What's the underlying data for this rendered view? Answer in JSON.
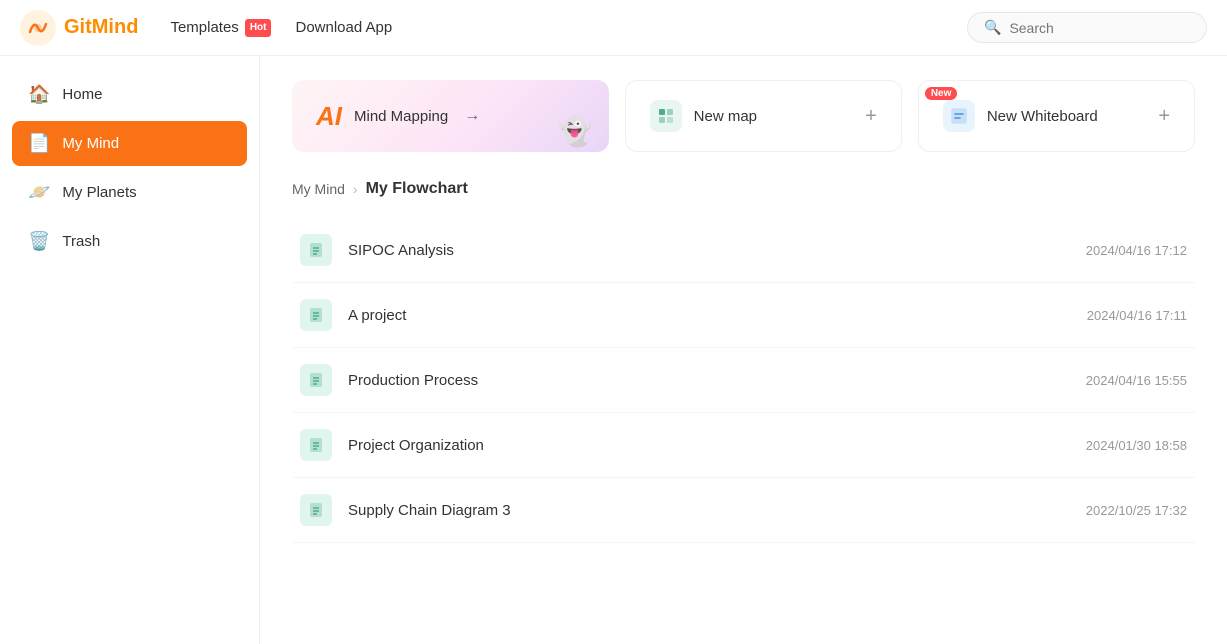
{
  "header": {
    "logo_text": "GitMind",
    "nav": [
      {
        "label": "Templates",
        "badge": "Hot"
      },
      {
        "label": "Download App"
      }
    ],
    "search_placeholder": "Search"
  },
  "sidebar": {
    "items": [
      {
        "id": "home",
        "label": "Home",
        "icon": "🏠",
        "active": false
      },
      {
        "id": "my-mind",
        "label": "My Mind",
        "icon": "📄",
        "active": true
      },
      {
        "id": "my-planets",
        "label": "My Planets",
        "icon": "🪐",
        "active": false
      },
      {
        "id": "trash",
        "label": "Trash",
        "icon": "🗑️",
        "active": false
      }
    ]
  },
  "action_cards": [
    {
      "id": "mind-mapping",
      "ai_label": "AI",
      "label": "Mind Mapping",
      "arrow": "→",
      "type": "mind"
    },
    {
      "id": "new-map",
      "label": "New map",
      "plus": "+",
      "type": "map"
    },
    {
      "id": "new-whiteboard",
      "label": "New Whiteboard",
      "plus": "+",
      "badge": "New",
      "type": "whiteboard"
    }
  ],
  "breadcrumb": {
    "parent": "My Mind",
    "current": "My Flowchart"
  },
  "files": [
    {
      "name": "SIPOC Analysis",
      "date": "2024/04/16 17:12"
    },
    {
      "name": "A project",
      "date": "2024/04/16 17:11"
    },
    {
      "name": "Production Process",
      "date": "2024/04/16 15:55"
    },
    {
      "name": "Project Organization",
      "date": "2024/01/30 18:58"
    },
    {
      "name": "Supply Chain Diagram 3",
      "date": "2022/10/25 17:32"
    }
  ],
  "colors": {
    "accent": "#f97316",
    "active_sidebar": "#f97316"
  }
}
